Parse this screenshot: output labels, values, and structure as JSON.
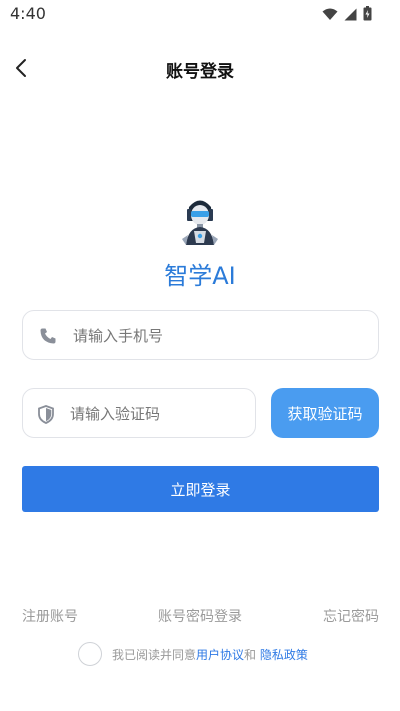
{
  "status_bar": {
    "time": "4:40",
    "icons": [
      "wifi-icon",
      "signal-icon",
      "battery-icon"
    ]
  },
  "header": {
    "title": "账号登录",
    "back_icon": "chevron-left-icon"
  },
  "app": {
    "logo_icon": "robot-avatar-icon",
    "name": "智学AI"
  },
  "form": {
    "phone": {
      "placeholder": "请输入手机号",
      "value": "",
      "icon": "phone-icon"
    },
    "code": {
      "placeholder": "请输入验证码",
      "value": "",
      "icon": "shield-icon"
    },
    "get_code_label": "获取验证码",
    "login_label": "立即登录"
  },
  "links": {
    "register": "注册账号",
    "password_login": "账号密码登录",
    "forgot_password": "忘记密码"
  },
  "agreement": {
    "checked": false,
    "prefix": "我已阅读并同意",
    "user_agreement": "用户协议",
    "and": "和 ",
    "privacy_policy": "隐私政策"
  },
  "colors": {
    "primary": "#2f7ae5",
    "code_button": "#4a9cf0",
    "app_name": "#2b7bd9"
  }
}
